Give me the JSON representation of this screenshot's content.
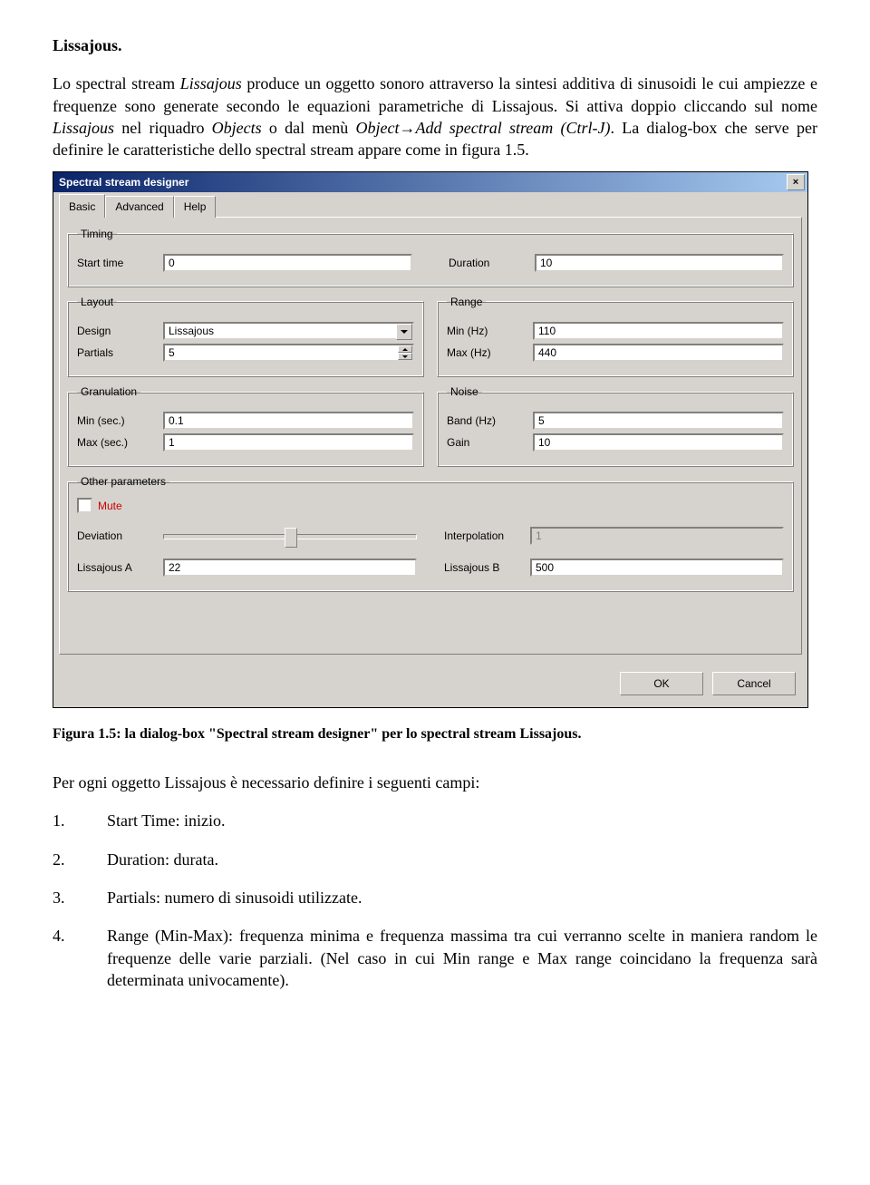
{
  "doc": {
    "heading": "Lissajous.",
    "para1_parts": [
      "Lo spectral stream ",
      "Lissajous",
      " produce un oggetto sonoro attraverso la sintesi additiva di sinusoidi le cui ampiezze e frequenze sono generate secondo le equazioni parametriche di Lissajous. Si attiva doppio cliccando sul nome ",
      "Lissajous",
      " nel riquadro ",
      "Objects",
      " o dal menù ",
      "Object",
      "→",
      "Add spectral stream (Ctrl-J)",
      ". La dialog-box che serve per definire le caratteristiche dello spectral stream appare come in figura 1.5."
    ],
    "caption": "Figura 1.5: la dialog-box \"Spectral stream designer\" per lo spectral stream Lissajous.",
    "para2": "Per ogni oggetto Lissajous è necessario definire i seguenti campi:",
    "list": [
      {
        "n": "1.",
        "t": "Start Time: inizio."
      },
      {
        "n": "2.",
        "t": "Duration: durata."
      },
      {
        "n": "3.",
        "t": "Partials: numero di sinusoidi utilizzate."
      },
      {
        "n": "4.",
        "t": "Range (Min-Max): frequenza minima e frequenza massima tra cui verranno scelte in maniera random le frequenze delle varie parziali. (Nel caso in cui Min range e Max range coincidano la frequenza sarà determinata univocamente)."
      }
    ]
  },
  "dlg": {
    "title": "Spectral stream designer",
    "tabs": [
      "Basic",
      "Advanced",
      "Help"
    ],
    "groups": {
      "timing": "Timing",
      "layout": "Layout",
      "range": "Range",
      "granulation": "Granulation",
      "noise": "Noise",
      "other": "Other parameters"
    },
    "labels": {
      "start": "Start time",
      "duration": "Duration",
      "design": "Design",
      "partials": "Partials",
      "minhz": "Min (Hz)",
      "maxhz": "Max (Hz)",
      "minsec": "Min (sec.)",
      "maxsec": "Max (sec.)",
      "bandhz": "Band (Hz)",
      "gain": "Gain",
      "mute": "Mute",
      "deviation": "Deviation",
      "interpolation": "Interpolation",
      "lissA": "Lissajous A",
      "lissB": "Lissajous B"
    },
    "values": {
      "start": "0",
      "duration": "10",
      "design": "Lissajous",
      "partials": "5",
      "minhz": "110",
      "maxhz": "440",
      "minsec": "0.1",
      "maxsec": "1",
      "bandhz": "5",
      "gain": "10",
      "interpolation": "1",
      "lissA": "22",
      "lissB": "500"
    },
    "buttons": {
      "ok": "OK",
      "cancel": "Cancel"
    }
  }
}
